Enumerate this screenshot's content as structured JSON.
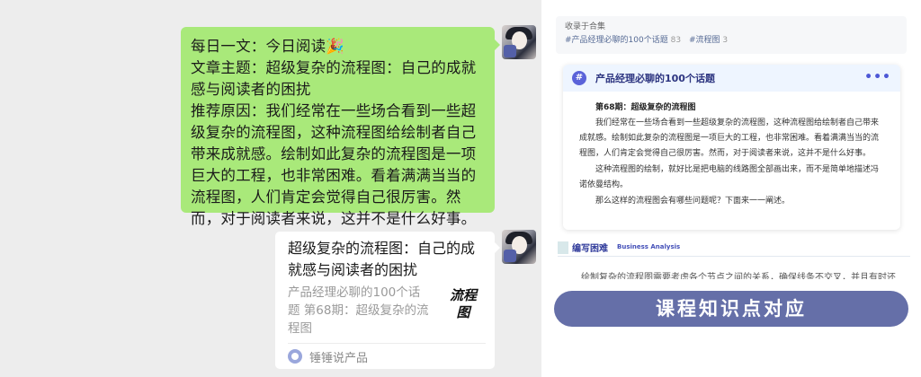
{
  "chat": {
    "message": {
      "lines": [
        "每日一文：今日阅读🎉",
        "文章主题：超级复杂的流程图：自己的成就感与阅读者的困扰",
        "推荐原因：我们经常在一些场合看到一些超级复杂的流程图，这种流程图给绘制者自己带来成就感。绘制如此复杂的流程图是一项巨大的工程，也非常困难。看着满满当当的流程图，人们肯定会觉得自己很厉害。然而，对于阅读者来说，这并不是什么好事。"
      ]
    },
    "card": {
      "title": "超级复杂的流程图：自己的成就感与阅读者的困扰",
      "description": "产品经理必聊的100个话题 第68期：超级复杂的流程图",
      "thumbnail_text": [
        "流程",
        "图"
      ],
      "source": "锤锤说产品"
    }
  },
  "article": {
    "collection": {
      "label": "收录于合集",
      "tags": [
        {
          "name": "#产品经理必聊的100个话题",
          "count": "83"
        },
        {
          "name": "#流程图",
          "count": "3"
        }
      ]
    },
    "topic": {
      "name": "产品经理必聊的100个话题",
      "issue": "第68期：超级复杂的流程图",
      "paragraphs": [
        "我们经常在一些场合看到一些超级复杂的流程图，这种流程图给绘制者自己带来成就感。绘制如此复杂的流程图是一项巨大的工程，也非常困难。看着满满当当的流程图，人们肯定会觉得自己很厉害。然而，对于阅读者来说，这并不是什么好事。",
        "这种流程图的绘制，就好比是把电脑的线路图全部画出来，而不是简单地描述冯诺依曼结构。",
        "那么这样的流程图会有哪些问题呢？下面来一一阐述。"
      ]
    },
    "section": {
      "title": "编写困难",
      "subtitle": "Business Analysis"
    },
    "cut_text": "绘制复杂的流程图需要考虑各个节点之间的关系，确保线条不交叉，并且有时还需要跨页"
  },
  "banner": "课程知识点对应",
  "colors": {
    "chat_bg": "#ededed",
    "bubble_green": "#a9e97a",
    "topic_accent": "#5b63d9",
    "banner_bg": "#656fa8"
  }
}
